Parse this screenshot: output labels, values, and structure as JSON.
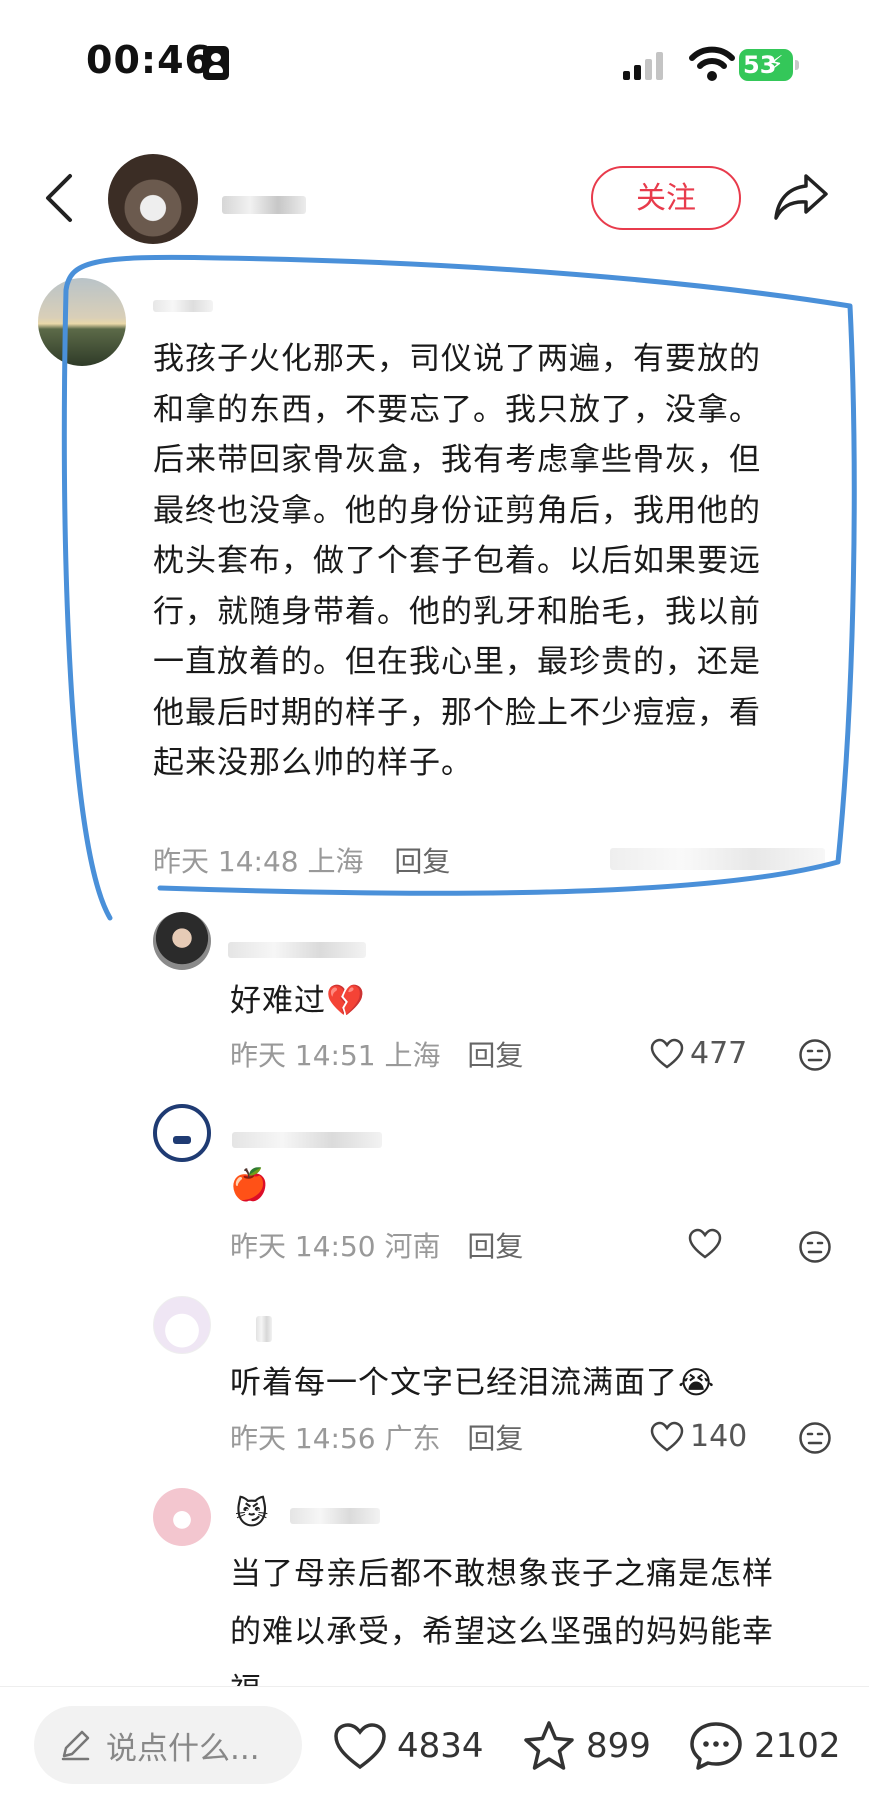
{
  "status_bar": {
    "time": "00:46",
    "battery": "53"
  },
  "header": {
    "follow_label": "关注"
  },
  "main_comment": {
    "text": "我孩子火化那天，司仪说了两遍，有要放的和拿的东西，不要忘了。我只放了，没拿。后来带回家骨灰盒，我有考虑拿些骨灰，但最终也没拿。他的身份证剪角后，我用他的枕头套布，做了个套子包着。以后如果要远行，就随身带着。他的乳牙和胎毛，我以前一直放着的。但在我心里，最珍贵的，还是他最后时期的样子，那个脸上不少痘痘，看起来没那么帅的样子。",
    "lines": [
      "我孩子火化那天，司仪说了两遍，有要放的",
      "和拿的东西，不要忘了。我只放了，没拿。",
      "后来带回家骨灰盒，我有考虑拿些骨灰，但",
      "最终也没拿。他的身份证剪角后，我用他的",
      "枕头套布，做了个套子包着。以后如果要远",
      "行，就随身带着。他的乳牙和胎毛，我以前",
      "一直放着的。但在我心里，最珍贵的，还是",
      "他最后时期的样子，那个脸上不少痘痘，看",
      "起来没那么帅的样子。"
    ],
    "time": "昨天 14:48",
    "location": "上海",
    "reply_label": "回复"
  },
  "replies": [
    {
      "text": "好难过💔",
      "time": "昨天 14:51",
      "location": "上海",
      "reply_label": "回复",
      "likes": "477"
    },
    {
      "text": "🍎",
      "time": "昨天 14:50",
      "location": "河南",
      "reply_label": "回复",
      "likes": ""
    },
    {
      "text": "听着每一个文字已经泪流满面了😭",
      "time": "昨天 14:56",
      "location": "广东",
      "reply_label": "回复",
      "likes": "140"
    },
    {
      "lines": [
        "当了母亲后都不敢想象丧子之痛是怎样",
        "的难以承受，希望这么坚强的妈妈能幸",
        "福"
      ]
    }
  ],
  "bottom_bar": {
    "placeholder": "说点什么...",
    "likes": "4834",
    "favorites": "899",
    "comments": "2102"
  },
  "colors": {
    "accent": "#e83b4c",
    "highlight": "#4a90d9",
    "battery": "#34c759"
  }
}
